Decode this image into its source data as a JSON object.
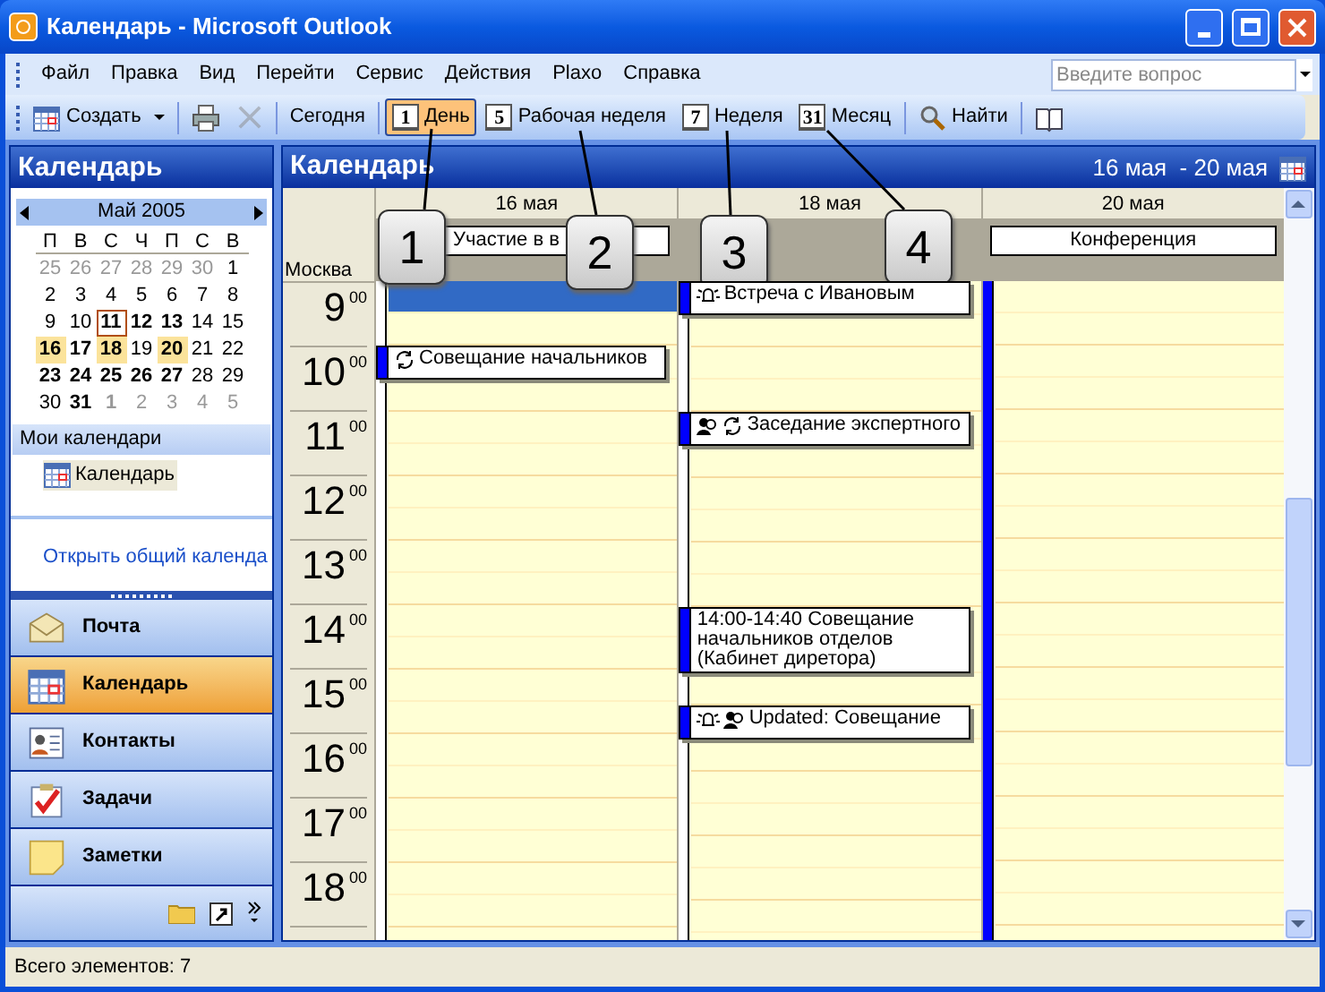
{
  "window": {
    "title": "Календарь - Microsoft Outlook"
  },
  "menu": [
    "Файл",
    "Правка",
    "Вид",
    "Перейти",
    "Сервис",
    "Действия",
    "Plaxo",
    "Справка"
  ],
  "help_search": {
    "placeholder": "Введите вопрос"
  },
  "toolbar": [
    {
      "kind": "new",
      "label": "Создать"
    },
    {
      "kind": "separator"
    },
    {
      "kind": "print",
      "disabled": false
    },
    {
      "kind": "delete",
      "disabled": true
    },
    {
      "kind": "separator"
    },
    {
      "kind": "text",
      "label": "Сегодня"
    },
    {
      "kind": "separator"
    },
    {
      "kind": "view",
      "badge": "1",
      "label": "День",
      "selected": true
    },
    {
      "kind": "view",
      "badge": "5",
      "label": "Рабочая неделя",
      "selected": false
    },
    {
      "kind": "view",
      "badge": "7",
      "label": "Неделя",
      "selected": false
    },
    {
      "kind": "view",
      "badge": "31",
      "label": "Месяц",
      "selected": false
    },
    {
      "kind": "separator"
    },
    {
      "kind": "find",
      "label": "Найти"
    },
    {
      "kind": "separator"
    },
    {
      "kind": "book"
    }
  ],
  "sidebar": {
    "title": "Календарь",
    "mini_calendar": {
      "month": "Май 2005",
      "weekdays": [
        "П",
        "В",
        "С",
        "Ч",
        "П",
        "С",
        "В"
      ],
      "weeks": [
        [
          {
            "d": "25",
            "muted": true,
            "bold": false,
            "selected": false,
            "today": false
          },
          {
            "d": "26",
            "muted": true,
            "bold": false,
            "selected": false,
            "today": false
          },
          {
            "d": "27",
            "muted": true,
            "bold": false,
            "selected": false,
            "today": false
          },
          {
            "d": "28",
            "muted": true,
            "bold": false,
            "selected": false,
            "today": false
          },
          {
            "d": "29",
            "muted": true,
            "bold": false,
            "selected": false,
            "today": false
          },
          {
            "d": "30",
            "muted": true,
            "bold": false,
            "selected": false,
            "today": false
          },
          {
            "d": "1",
            "muted": false,
            "bold": false,
            "selected": false,
            "today": false
          }
        ],
        [
          {
            "d": "2",
            "muted": false,
            "bold": false,
            "selected": false,
            "today": false
          },
          {
            "d": "3",
            "muted": false,
            "bold": false,
            "selected": false,
            "today": false
          },
          {
            "d": "4",
            "muted": false,
            "bold": false,
            "selected": false,
            "today": false
          },
          {
            "d": "5",
            "muted": false,
            "bold": false,
            "selected": false,
            "today": false
          },
          {
            "d": "6",
            "muted": false,
            "bold": false,
            "selected": false,
            "today": false
          },
          {
            "d": "7",
            "muted": false,
            "bold": false,
            "selected": false,
            "today": false
          },
          {
            "d": "8",
            "muted": false,
            "bold": false,
            "selected": false,
            "today": false
          }
        ],
        [
          {
            "d": "9",
            "muted": false,
            "bold": false,
            "selected": false,
            "today": false
          },
          {
            "d": "10",
            "muted": false,
            "bold": false,
            "selected": false,
            "today": false
          },
          {
            "d": "11",
            "muted": false,
            "bold": true,
            "selected": false,
            "today": true
          },
          {
            "d": "12",
            "muted": false,
            "bold": true,
            "selected": false,
            "today": false
          },
          {
            "d": "13",
            "muted": false,
            "bold": true,
            "selected": false,
            "today": false
          },
          {
            "d": "14",
            "muted": false,
            "bold": false,
            "selected": false,
            "today": false
          },
          {
            "d": "15",
            "muted": false,
            "bold": false,
            "selected": false,
            "today": false
          }
        ],
        [
          {
            "d": "16",
            "muted": false,
            "bold": true,
            "selected": true,
            "today": false
          },
          {
            "d": "17",
            "muted": false,
            "bold": true,
            "selected": false,
            "today": false
          },
          {
            "d": "18",
            "muted": false,
            "bold": true,
            "selected": true,
            "today": false
          },
          {
            "d": "19",
            "muted": false,
            "bold": false,
            "selected": false,
            "today": false
          },
          {
            "d": "20",
            "muted": false,
            "bold": true,
            "selected": true,
            "today": false
          },
          {
            "d": "21",
            "muted": false,
            "bold": false,
            "selected": false,
            "today": false
          },
          {
            "d": "22",
            "muted": false,
            "bold": false,
            "selected": false,
            "today": false
          }
        ],
        [
          {
            "d": "23",
            "muted": false,
            "bold": true,
            "selected": false,
            "today": false
          },
          {
            "d": "24",
            "muted": false,
            "bold": true,
            "selected": false,
            "today": false
          },
          {
            "d": "25",
            "muted": false,
            "bold": true,
            "selected": false,
            "today": false
          },
          {
            "d": "26",
            "muted": false,
            "bold": true,
            "selected": false,
            "today": false
          },
          {
            "d": "27",
            "muted": false,
            "bold": true,
            "selected": false,
            "today": false
          },
          {
            "d": "28",
            "muted": false,
            "bold": false,
            "selected": false,
            "today": false
          },
          {
            "d": "29",
            "muted": false,
            "bold": false,
            "selected": false,
            "today": false
          }
        ],
        [
          {
            "d": "30",
            "muted": false,
            "bold": false,
            "selected": false,
            "today": false
          },
          {
            "d": "31",
            "muted": false,
            "bold": true,
            "selected": false,
            "today": false
          },
          {
            "d": "1",
            "muted": true,
            "bold": true,
            "selected": false,
            "today": false
          },
          {
            "d": "2",
            "muted": true,
            "bold": false,
            "selected": false,
            "today": false
          },
          {
            "d": "3",
            "muted": true,
            "bold": false,
            "selected": false,
            "today": false
          },
          {
            "d": "4",
            "muted": true,
            "bold": false,
            "selected": false,
            "today": false
          },
          {
            "d": "5",
            "muted": true,
            "bold": false,
            "selected": false,
            "today": false
          }
        ]
      ]
    },
    "my_calendars": {
      "title": "Мои календари",
      "items": [
        {
          "label": "Календарь",
          "selected": true
        }
      ]
    },
    "open_shared_link": "Открыть общий календа",
    "nav_buttons": [
      {
        "kind": "mail",
        "label": "Почта",
        "selected": false
      },
      {
        "kind": "calendar",
        "label": "Календарь",
        "selected": true
      },
      {
        "kind": "contacts",
        "label": "Контакты",
        "selected": false
      },
      {
        "kind": "tasks",
        "label": "Задачи",
        "selected": false
      },
      {
        "kind": "notes",
        "label": "Заметки",
        "selected": false
      }
    ]
  },
  "calendar": {
    "title": "Календарь",
    "range": "16 мая  - 20 мая",
    "timezone": "Москва",
    "hours": [
      {
        "hour": "9",
        "minutes": "00"
      },
      {
        "hour": "10",
        "minutes": "00"
      },
      {
        "hour": "11",
        "minutes": "00"
      },
      {
        "hour": "12",
        "minutes": "00"
      },
      {
        "hour": "13",
        "minutes": "00"
      },
      {
        "hour": "14",
        "minutes": "00"
      },
      {
        "hour": "15",
        "minutes": "00"
      },
      {
        "hour": "16",
        "minutes": "00"
      },
      {
        "hour": "17",
        "minutes": "00"
      },
      {
        "hour": "18",
        "minutes": "00"
      }
    ],
    "days": [
      {
        "label": "16 мая",
        "all_day": [
          {
            "title": "Участие в в",
            "busy": false
          }
        ],
        "slots": [
          {
            "selected": true
          },
          {
            "selected": false
          },
          {
            "selected": false,
            "event": {
              "title": "Совещание начальников",
              "reminder": false,
              "recurring": true,
              "meeting": false
            }
          },
          {
            "selected": false
          },
          {
            "selected": false
          },
          {
            "selected": false
          },
          {
            "selected": false
          },
          {
            "selected": false
          },
          {
            "selected": false
          },
          {
            "selected": false
          },
          {
            "selected": false
          },
          {
            "selected": false
          },
          {
            "selected": false
          },
          {
            "selected": false
          },
          {
            "selected": false
          },
          {
            "selected": false
          },
          {
            "selected": false
          },
          {
            "selected": false
          },
          {
            "selected": false
          },
          {
            "selected": false
          }
        ]
      },
      {
        "label": "18 мая",
        "slots": [
          {
            "selected": false,
            "event": {
              "title": "Встреча с Ивановым",
              "reminder": true,
              "recurring": false,
              "meeting": false
            }
          },
          {
            "selected": false
          },
          {
            "selected": false
          },
          {
            "selected": false
          },
          {
            "selected": false,
            "event": {
              "title": "Заседание экспертного",
              "reminder": false,
              "recurring": true,
              "meeting": true
            }
          },
          {
            "selected": false
          },
          {
            "selected": false
          },
          {
            "selected": false
          },
          {
            "selected": false
          },
          {
            "selected": false
          },
          {
            "selected": false,
            "event": {
              "title": "14:00-14:40 Совещание начальников отделов (Кабинет диретора)",
              "reminder": false,
              "recurring": false,
              "meeting": false
            }
          },
          {
            "selected": false
          },
          {
            "selected": false,
            "event": {
              "title": "Updated: Совещание",
              "reminder": true,
              "recurring": false,
              "meeting": true
            }
          },
          {
            "selected": false
          },
          {
            "selected": false
          },
          {
            "selected": false
          },
          {
            "selected": false
          },
          {
            "selected": false
          },
          {
            "selected": false
          }
        ]
      },
      {
        "label": "20 мая",
        "all_day": [
          {
            "title": "Конференция",
            "busy": true
          }
        ],
        "slots": [
          {
            "selected": false
          },
          {
            "selected": false
          },
          {
            "selected": false
          },
          {
            "selected": false
          },
          {
            "selected": false
          },
          {
            "selected": false
          },
          {
            "selected": false
          },
          {
            "selected": false
          },
          {
            "selected": false
          },
          {
            "selected": false
          },
          {
            "selected": false
          },
          {
            "selected": false
          },
          {
            "selected": false
          },
          {
            "selected": false
          },
          {
            "selected": false
          },
          {
            "selected": false
          },
          {
            "selected": false
          },
          {
            "selected": false
          },
          {
            "selected": false
          },
          {
            "selected": false
          }
        ]
      }
    ]
  },
  "callouts": [
    "1",
    "2",
    "3",
    "4"
  ],
  "status_bar": "Всего элементов: 7"
}
